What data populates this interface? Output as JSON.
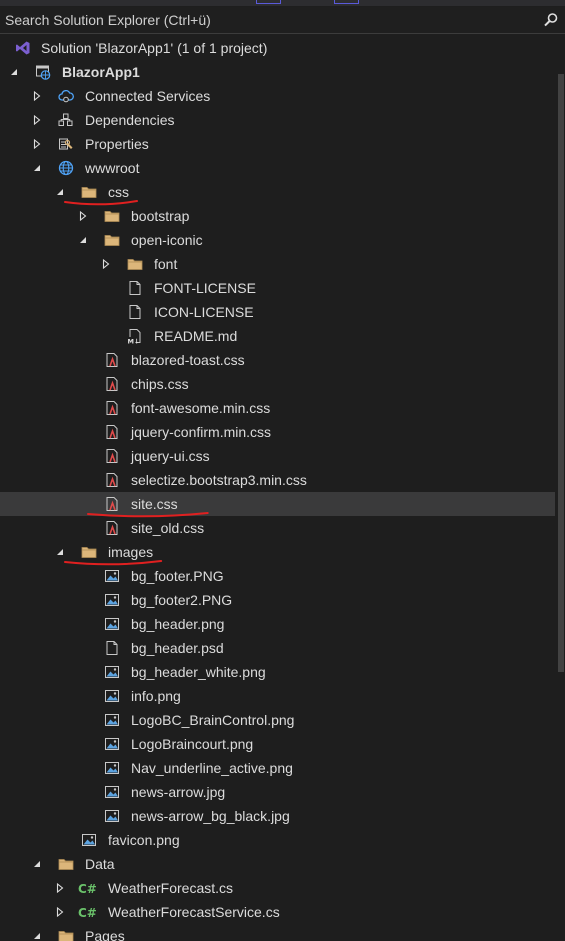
{
  "search": {
    "placeholder": "Search Solution Explorer (Ctrl+ü)",
    "icon": "search-icon"
  },
  "colors": {
    "background": "#1e1e1e",
    "selection": "#3a3a3b",
    "folder": "#dcb67a",
    "csharp": "#6ac16a",
    "annotation": "#e02020"
  },
  "tree": [
    {
      "label": "Solution 'BlazorApp1' (1 of 1 project)",
      "icon": "solution",
      "level": 0,
      "expander": "none"
    },
    {
      "label": "BlazorApp1",
      "icon": "project",
      "level": 0,
      "expander": "expanded",
      "bold": true
    },
    {
      "label": "Connected Services",
      "icon": "connected",
      "level": 1,
      "expander": "collapsed"
    },
    {
      "label": "Dependencies",
      "icon": "dependencies",
      "level": 1,
      "expander": "collapsed"
    },
    {
      "label": "Properties",
      "icon": "properties",
      "level": 1,
      "expander": "collapsed"
    },
    {
      "label": "wwwroot",
      "icon": "globe",
      "level": 1,
      "expander": "expanded"
    },
    {
      "label": "css",
      "icon": "folder",
      "level": 2,
      "expander": "expanded",
      "annotated": true
    },
    {
      "label": "bootstrap",
      "icon": "folder",
      "level": 3,
      "expander": "collapsed"
    },
    {
      "label": "open-iconic",
      "icon": "folder",
      "level": 3,
      "expander": "expanded"
    },
    {
      "label": "font",
      "icon": "folder",
      "level": 4,
      "expander": "collapsed"
    },
    {
      "label": "FONT-LICENSE",
      "icon": "file",
      "level": 4,
      "expander": "none"
    },
    {
      "label": "ICON-LICENSE",
      "icon": "file",
      "level": 4,
      "expander": "none"
    },
    {
      "label": "README.md",
      "icon": "markdown",
      "level": 4,
      "expander": "none"
    },
    {
      "label": "blazored-toast.css",
      "icon": "css",
      "level": 3,
      "expander": "none"
    },
    {
      "label": "chips.css",
      "icon": "css",
      "level": 3,
      "expander": "none"
    },
    {
      "label": "font-awesome.min.css",
      "icon": "css",
      "level": 3,
      "expander": "none"
    },
    {
      "label": "jquery-confirm.min.css",
      "icon": "css",
      "level": 3,
      "expander": "none"
    },
    {
      "label": "jquery-ui.css",
      "icon": "css",
      "level": 3,
      "expander": "none"
    },
    {
      "label": "selectize.bootstrap3.min.css",
      "icon": "css",
      "level": 3,
      "expander": "none"
    },
    {
      "label": "site.css",
      "icon": "css",
      "level": 3,
      "expander": "none",
      "selected": true,
      "annotated": true
    },
    {
      "label": "site_old.css",
      "icon": "css",
      "level": 3,
      "expander": "none"
    },
    {
      "label": "images",
      "icon": "folder",
      "level": 2,
      "expander": "expanded",
      "annotated": true
    },
    {
      "label": "bg_footer.PNG",
      "icon": "image",
      "level": 3,
      "expander": "none"
    },
    {
      "label": "bg_footer2.PNG",
      "icon": "image",
      "level": 3,
      "expander": "none"
    },
    {
      "label": "bg_header.png",
      "icon": "image",
      "level": 3,
      "expander": "none"
    },
    {
      "label": "bg_header.psd",
      "icon": "file",
      "level": 3,
      "expander": "none"
    },
    {
      "label": "bg_header_white.png",
      "icon": "image",
      "level": 3,
      "expander": "none"
    },
    {
      "label": "info.png",
      "icon": "image",
      "level": 3,
      "expander": "none"
    },
    {
      "label": "LogoBC_BrainControl.png",
      "icon": "image",
      "level": 3,
      "expander": "none"
    },
    {
      "label": "LogoBraincourt.png",
      "icon": "image",
      "level": 3,
      "expander": "none"
    },
    {
      "label": "Nav_underline_active.png",
      "icon": "image",
      "level": 3,
      "expander": "none"
    },
    {
      "label": "news-arrow.jpg",
      "icon": "image",
      "level": 3,
      "expander": "none"
    },
    {
      "label": "news-arrow_bg_black.jpg",
      "icon": "image",
      "level": 3,
      "expander": "none"
    },
    {
      "label": "favicon.png",
      "icon": "image",
      "level": 2,
      "expander": "none"
    },
    {
      "label": "Data",
      "icon": "folder",
      "level": 1,
      "expander": "expanded"
    },
    {
      "label": "WeatherForecast.cs",
      "icon": "csharp",
      "level": 2,
      "expander": "collapsed"
    },
    {
      "label": "WeatherForecastService.cs",
      "icon": "csharp",
      "level": 2,
      "expander": "collapsed"
    },
    {
      "label": "Pages",
      "icon": "folder",
      "level": 1,
      "expander": "expanded"
    }
  ]
}
